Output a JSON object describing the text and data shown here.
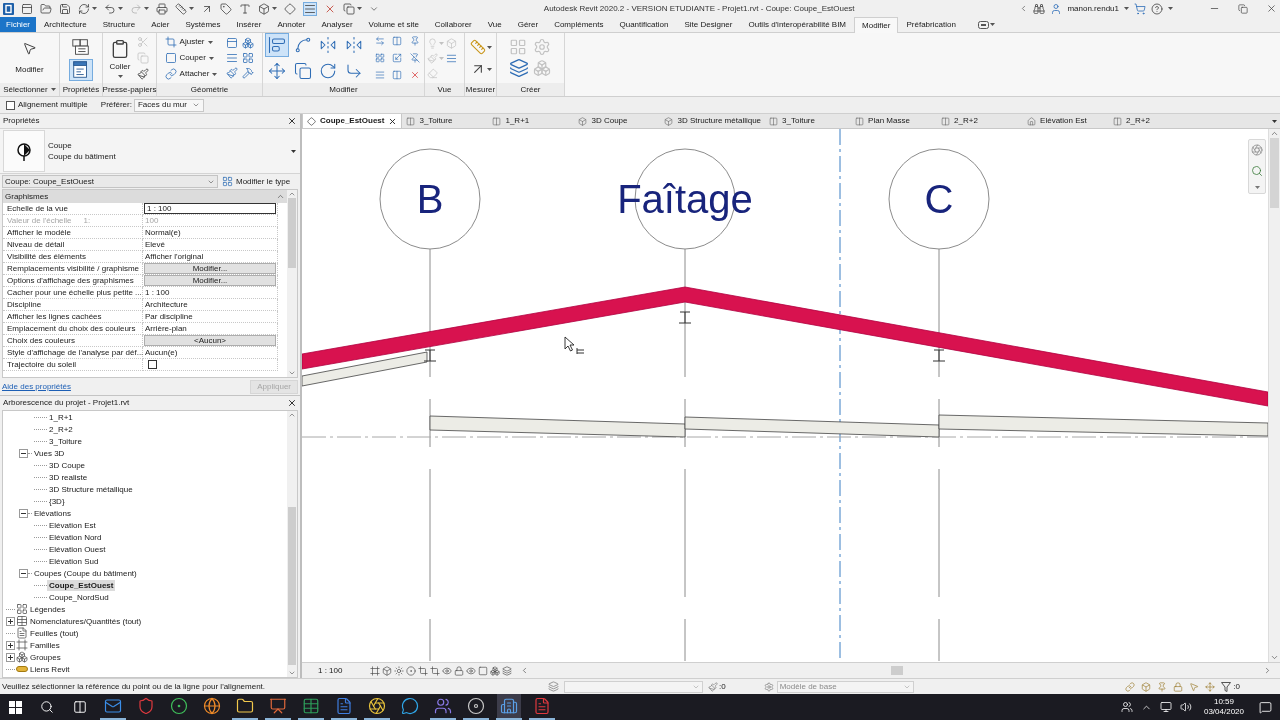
{
  "title_bar": {
    "title": "Autodesk Revit 2020.2 - VERSION ETUDIANTE - Projet1.rvt - Coupe: Coupe_EstOuest",
    "user": "manon.rendu1",
    "toggle": {
      "on": true
    }
  },
  "menu_tabs": [
    {
      "label": "Fichier",
      "kind": "file",
      "selected": false
    },
    {
      "label": "Architecture",
      "kind": "tab",
      "selected": false
    },
    {
      "label": "Structure",
      "kind": "tab",
      "selected": false
    },
    {
      "label": "Acier",
      "kind": "tab",
      "selected": false
    },
    {
      "label": "Systèmes",
      "kind": "tab",
      "selected": false
    },
    {
      "label": "Insérer",
      "kind": "tab",
      "selected": false
    },
    {
      "label": "Annoter",
      "kind": "tab",
      "selected": false
    },
    {
      "label": "Analyser",
      "kind": "tab",
      "selected": false
    },
    {
      "label": "Volume et site",
      "kind": "tab",
      "selected": false
    },
    {
      "label": "Collaborer",
      "kind": "tab",
      "selected": false
    },
    {
      "label": "Vue",
      "kind": "tab",
      "selected": false
    },
    {
      "label": "Gérer",
      "kind": "tab",
      "selected": false
    },
    {
      "label": "Compléments",
      "kind": "tab",
      "selected": false
    },
    {
      "label": "Quantification",
      "kind": "tab",
      "selected": false
    },
    {
      "label": "Site Designer",
      "kind": "tab",
      "selected": false
    },
    {
      "label": "Outils d'interopérabilité BIM",
      "kind": "tab",
      "selected": false
    },
    {
      "label": "Modifier",
      "kind": "tab",
      "selected": true
    },
    {
      "label": "Préfabrication",
      "kind": "tab",
      "selected": false
    }
  ],
  "ribbon": {
    "panels": [
      {
        "label": "Sélectionner",
        "tools": [
          {
            "label": "Modifier"
          }
        ]
      },
      {
        "label": "Propriétés",
        "tools": [
          {
            "selected": false
          },
          {
            "selected": true
          }
        ]
      },
      {
        "label": "Presse-papiers",
        "tools": [
          {
            "label": "Coller"
          },
          {
            "disabled": true
          },
          {
            "disabled": true
          },
          {
            "disabled": false
          }
        ]
      },
      {
        "label": "Géométrie",
        "tools": [
          {
            "label": "Ajuster"
          },
          {
            "label": "Couper"
          },
          {
            "label": "Attacher"
          }
        ]
      },
      {
        "label": "Modifier",
        "tools": [
          {
            "selected": true
          },
          {
            "selected": false
          },
          {
            "selected": false
          },
          {
            "selected": false
          },
          {
            "selected": false
          },
          {
            "selected": false
          },
          {
            "selected": false
          },
          {
            "selected": false
          },
          {
            "selected": false
          },
          {
            "selected": false
          },
          {
            "selected": false
          },
          {
            "selected": false
          },
          {
            "selected": false
          },
          {
            "selected": false
          },
          {
            "selected": false
          },
          {
            "selected": false
          },
          {
            "selected": false
          }
        ]
      },
      {
        "label": "Vue",
        "tools": [
          {
            "disabled": true
          },
          {
            "disabled": true
          },
          {
            "disabled": true
          },
          {
            "disabled": false
          },
          {
            "disabled": true
          }
        ]
      },
      {
        "label": "Mesurer"
      },
      {
        "label": "Créer",
        "tools": [
          {
            "disabled": true
          },
          {
            "disabled": true
          },
          {
            "disabled": false
          },
          {
            "disabled": true
          }
        ]
      }
    ]
  },
  "options_bar": {
    "multiple": {
      "label": "Alignement multiple",
      "checked": false
    },
    "prefer": {
      "label": "Préférer:",
      "value": "Faces du mur"
    }
  },
  "properties": {
    "title": "Propriétés",
    "type": {
      "name": "Coupe",
      "family": "Coupe du bâtiment"
    },
    "instance": "Coupe: Coupe_EstOuest",
    "edit_type": "Modifier le type",
    "category": "Graphismes",
    "rows": [
      {
        "label": "Echelle de la vue",
        "value": "1 : 100",
        "kind": "input"
      },
      {
        "label": "Valeur de l'échelle",
        "suffix": "1:",
        "value": "100",
        "kind": "readonly"
      },
      {
        "label": "Afficher le modèle",
        "value": "Normal(e)",
        "kind": "text"
      },
      {
        "label": "Niveau de détail",
        "value": "Elevé",
        "kind": "text"
      },
      {
        "label": "Visibilité des éléments",
        "value": "Afficher l'original",
        "kind": "text"
      },
      {
        "label": "Remplacements visibilité / graphisme",
        "value": "Modifier...",
        "kind": "button"
      },
      {
        "label": "Options d'affichage des graphismes",
        "value": "Modifier...",
        "kind": "button"
      },
      {
        "label": "Cacher pour une échelle plus petite ...",
        "value": "1 : 100",
        "kind": "text"
      },
      {
        "label": "Discipline",
        "value": "Architecture",
        "kind": "text"
      },
      {
        "label": "Afficher les lignes cachées",
        "value": "Par discipline",
        "kind": "text"
      },
      {
        "label": "Emplacement du choix des couleurs",
        "value": "Arrière-plan",
        "kind": "text"
      },
      {
        "label": "Choix des couleurs",
        "value": "<Aucun>",
        "kind": "button"
      },
      {
        "label": "Style d'affichage de l'analyse par déf...",
        "value": "Aucun(e)",
        "kind": "text"
      },
      {
        "label": "Trajectoire du soleil",
        "kind": "checkbox",
        "checked": false
      }
    ],
    "help_link": "Aide des propriétés",
    "apply": {
      "label": "Appliquer",
      "disabled": true
    }
  },
  "project_browser": {
    "title": "Arborescence du projet - Projet1.rvt",
    "tree": [
      {
        "children": [
          {
            "children": [
              {
                "label": "1_R+1",
                "selected": false
              },
              {
                "label": "2_R+2",
                "selected": false
              },
              {
                "label": "3_Toiture",
                "selected": false
              }
            ]
          },
          {
            "label": "Vues 3D",
            "expanded": true,
            "selected": false,
            "children": [
              {
                "label": "3D Coupe",
                "selected": false
              },
              {
                "label": "3D realiste",
                "selected": false
              },
              {
                "label": "3D Structure métallique",
                "selected": false
              },
              {
                "label": "{3D}",
                "selected": false
              }
            ]
          },
          {
            "label": "Elévations",
            "expanded": true,
            "selected": false,
            "children": [
              {
                "label": "Elévation Est",
                "selected": false
              },
              {
                "label": "Elévation Nord",
                "selected": false
              },
              {
                "label": "Elévation Ouest",
                "selected": false
              },
              {
                "label": "Elévation Sud",
                "selected": false
              }
            ]
          },
          {
            "label": "Coupes (Coupe du bâtiment)",
            "expanded": true,
            "selected": false,
            "children": [
              {
                "label": "Coupe_EstOuest",
                "selected": true
              },
              {
                "label": "Coupe_NordSud",
                "selected": false
              }
            ]
          }
        ]
      },
      {
        "label": "Légendes",
        "kind": "legend",
        "selected": false
      },
      {
        "label": "Nomenclatures/Quantités (tout)",
        "kind": "schedule",
        "expanded": false,
        "selected": false
      },
      {
        "label": "Feuilles (tout)",
        "kind": "sheet",
        "selected": false
      },
      {
        "label": "Familles",
        "kind": "family",
        "expanded": false,
        "selected": false
      },
      {
        "label": "Groupes",
        "kind": "group",
        "expanded": false,
        "selected": false
      },
      {
        "label": "Liens Revit",
        "kind": "link",
        "selected": false
      }
    ]
  },
  "view_tabs": [
    {
      "label": "Coupe_EstOuest",
      "kind": "section",
      "selected": true
    },
    {
      "label": "3_Toiture",
      "kind": "plan",
      "selected": false
    },
    {
      "label": "1_R+1",
      "kind": "plan",
      "selected": false
    },
    {
      "label": "3D Coupe",
      "kind": "model",
      "selected": false
    },
    {
      "label": "3D Structure métallique",
      "kind": "model",
      "selected": false
    },
    {
      "label": "3_Toiture",
      "kind": "plan",
      "selected": false
    },
    {
      "label": "Plan Masse",
      "kind": "plan",
      "selected": false
    },
    {
      "label": "2_R+2",
      "kind": "plan",
      "selected": false
    },
    {
      "label": "Elévation Est",
      "kind": "elevation",
      "selected": false
    },
    {
      "label": "2_R+2",
      "kind": "plan",
      "selected": false
    }
  ],
  "canvas": {
    "grids": [
      {
        "label": "B"
      },
      {
        "label": "Faîtage"
      },
      {
        "label": "C"
      }
    ]
  },
  "view_control": {
    "scale": "1 : 100"
  },
  "status_bar": {
    "message": "Veuillez sélectionner la référence du point ou de la ligne pour l'alignement.",
    "editable_count": ":0",
    "design_option": "Modèle de base",
    "selection_count": ":0"
  },
  "taskbar": {
    "apps": [
      {
        "kind": "mail",
        "selected": false,
        "running": true
      },
      {
        "kind": "shield",
        "selected": false,
        "running": false
      },
      {
        "kind": "notes",
        "selected": false,
        "running": false
      },
      {
        "kind": "browser",
        "selected": false,
        "running": false
      },
      {
        "kind": "folder",
        "selected": false,
        "running": true
      },
      {
        "kind": "slides",
        "selected": false,
        "running": true
      },
      {
        "kind": "sheet",
        "selected": false,
        "running": true
      },
      {
        "kind": "doc",
        "selected": false,
        "running": true
      },
      {
        "kind": "aperture",
        "selected": false,
        "running": true
      },
      {
        "kind": "chat",
        "selected": false,
        "running": false
      },
      {
        "kind": "team",
        "selected": false,
        "running": true
      },
      {
        "kind": "disc",
        "selected": false,
        "running": true
      },
      {
        "kind": "cad",
        "selected": true,
        "running": true
      },
      {
        "kind": "pdf",
        "selected": false,
        "running": true
      }
    ],
    "time": "10:59",
    "date": "03/04/2020"
  }
}
